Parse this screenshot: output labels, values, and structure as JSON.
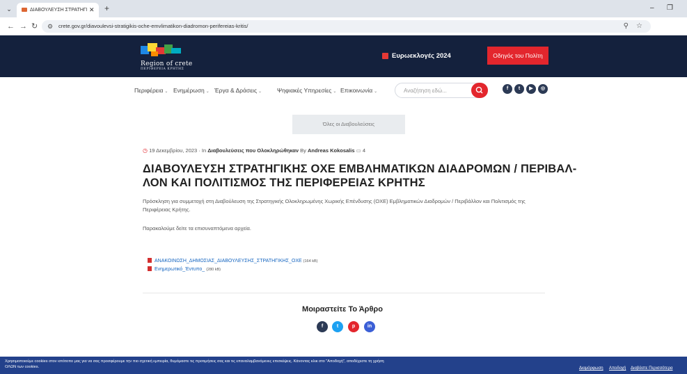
{
  "browser": {
    "tab_title": "ΔΙΑΒΟΥΛΕΥΣΗ ΣΤΡΑΤΗΓΙΚΗΣ Ο",
    "tab_close": "✕",
    "new_tab": "+",
    "url": "crete.gov.gr/diavoulevsi-stratigikis-oche-emvlimatikon-diadromon-perifereias-kritis/",
    "icons": [
      "back-arrow-icon",
      "forward-arrow-icon",
      "reload-icon",
      "site-settings-icon",
      "zoom-icon",
      "bookmark-star-icon",
      "profile-icon",
      "minimize-icon",
      "restore-icon"
    ]
  },
  "header": {
    "logo_text": "Region of crete",
    "logo_sub": "ΠΕΡΙΦΕΡΕΙΑ ΚΡΗΤΗΣ",
    "elections_label": "Ευρωεκλογές 2024",
    "citizen_button": "Οδηγός του Πολίτη",
    "colors": {
      "bar": "#14213d",
      "accent": "#e3262d"
    }
  },
  "nav": {
    "items": [
      {
        "label": "Περιφέρεια"
      },
      {
        "label": "Ενημέρωση"
      },
      {
        "label": "Έργα & Δράσεις"
      },
      {
        "label": "Ψηφιακές Υπηρεσίες"
      },
      {
        "label": "Επικοινωνία"
      }
    ],
    "search_placeholder": "Αναζήτηση εδώ...",
    "social_icons": [
      "facebook-icon",
      "twitter-icon",
      "youtube-icon",
      "instagram-icon"
    ]
  },
  "article": {
    "all_consultations_button": "Όλες οι Διαβουλεύσεις",
    "date": "19 Δεκεμβρίου, 2023",
    "in_label": "· In",
    "category": "Διαβουλεύσεις που Ολοκληρώθηκαν",
    "by_label": "By",
    "author": "Andreas Kokosalis",
    "comments": "4",
    "title_line1": "ΔΙΑΒΟΥΛΕΥΣΗ ΣΤΡΑΤΗΓΙΚΗΣ ΟΧΕ ΕΜΒΛΗΜΑΤΙΚΩΝ ΔΙΑΔΡΟΜΩΝ / ΠΕΡΙΒΑΛ-",
    "title_line2": "ΛΟΝ ΚΑΙ ΠΟΛΙΤΙΣΜΟΣ ΤΗΣ ΠΕΡΙΦΕΡΕΙΑΣ ΚΡΗΤΗΣ",
    "intro_line1": "Πρόσκληση για συμμετοχή στη Διαβούλευση της Στρατηγικής Ολοκληρωμένης Χωρικής Επένδυσης (ΟΧΕ) Εμβληματικών Διαδρομών / Περιβάλλον και Πολιτισμός της",
    "intro_line2": "Περιφέρειας Κρήτης.",
    "note": "Παρακαλούμε δείτε τα επισυναπτόμενα αρχεία.",
    "attachments": [
      {
        "name": "ΑΝΑΚΟΙΝΩΣΗ_ΔΗΜΟΣΙΑΣ_ΔΙΑΒΟΥΛΕΥΣΗΣ_ΣΤΡΑΤΗΓΙΚΗΣ_ΟΧΕ",
        "size": "(164 kB)"
      },
      {
        "name": "Ενημερωτικό_Έντυπο_",
        "size": "(280 kB)"
      }
    ]
  },
  "share": {
    "title": "Μοιραστείτε Το Άρθρο",
    "icons": [
      {
        "name": "facebook-share-icon",
        "color": "#2c3a55",
        "glyph": "f"
      },
      {
        "name": "twitter-share-icon",
        "color": "#1da1f2",
        "glyph": "t"
      },
      {
        "name": "pinterest-share-icon",
        "color": "#e3262d",
        "glyph": "p"
      },
      {
        "name": "linkedin-share-icon",
        "color": "#3b5fd6",
        "glyph": "in"
      }
    ]
  },
  "cookie": {
    "text_line1": "Χρησιμοποιούμε cookies στον ιστότοπο μας για να σας προσφέρουμε την πιο σχετική εμπειρία, θυμόμαστε τις προτιμήσεις σας και τις επαναλαμβανόμενες επισκέψεις. Κάνοντας κλικ στο \"Αποδοχή\", αποδέχεστε τη χρήση",
    "text_line2": "ΟΛΩΝ των cookies.",
    "manage": "Διαμόρφωση",
    "accept": "Αποδοχή",
    "read_more": "Διαβάστε Περισσότερα",
    "color": "#23418b"
  }
}
